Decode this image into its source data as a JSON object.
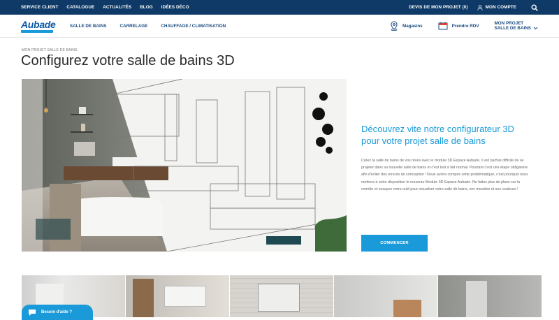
{
  "topbar": {
    "links": [
      "SERVICE CLIENT",
      "CATALOGUE",
      "ACTUALITÉS",
      "BLOG",
      "IDÉES DÉCO"
    ],
    "devis": "DEVIS DE MON PROJET (0)",
    "account": "MON COMPTE"
  },
  "nav": {
    "logo_text": "Aubade",
    "links": [
      "SALLE DE BAINS",
      "CARRELAGE",
      "CHAUFFAGE / CLIMATISATION"
    ],
    "stores": "Magasins",
    "appointment": "Prendre RDV",
    "project_line1": "MON PROJET",
    "project_line2": "SALLE DE BAINS"
  },
  "page": {
    "breadcrumb": "MON PROJET SALLE DE BAINS",
    "title": "Configurez votre salle de bains 3D",
    "heading": "Découvrez vite notre configurateur 3D pour votre projet salle de bains",
    "body": "Créez la salle de bains de vos rêves avec le module 3D Espace Aubade. Il est parfois difficile de se projeter dans sa nouvelle salle de bains et c'est tout à fait normal. Pourtant c'est une étape obligatoire afin d'éviter des erreurs de conception ! Nous avons compris cette problématique, c'est pourquoi nous mettons à votre disposition le nouveau Module 3D Espace Aubade. Ne faites plus de plans sur la comète et essayez notre outil pour visualiser votre salle de bains, ses meubles et ses couleurs !",
    "cta": "COMMENCER"
  },
  "help": {
    "label": "Besoin d'aide ?"
  },
  "colors": {
    "navy": "#0f3a67",
    "accent": "#1a9ad8",
    "nav_text": "#1a4b80"
  },
  "icons": [
    "user-icon",
    "search-icon",
    "map-pin-icon",
    "calendar-icon",
    "chevron-down-icon",
    "chat-icon"
  ]
}
